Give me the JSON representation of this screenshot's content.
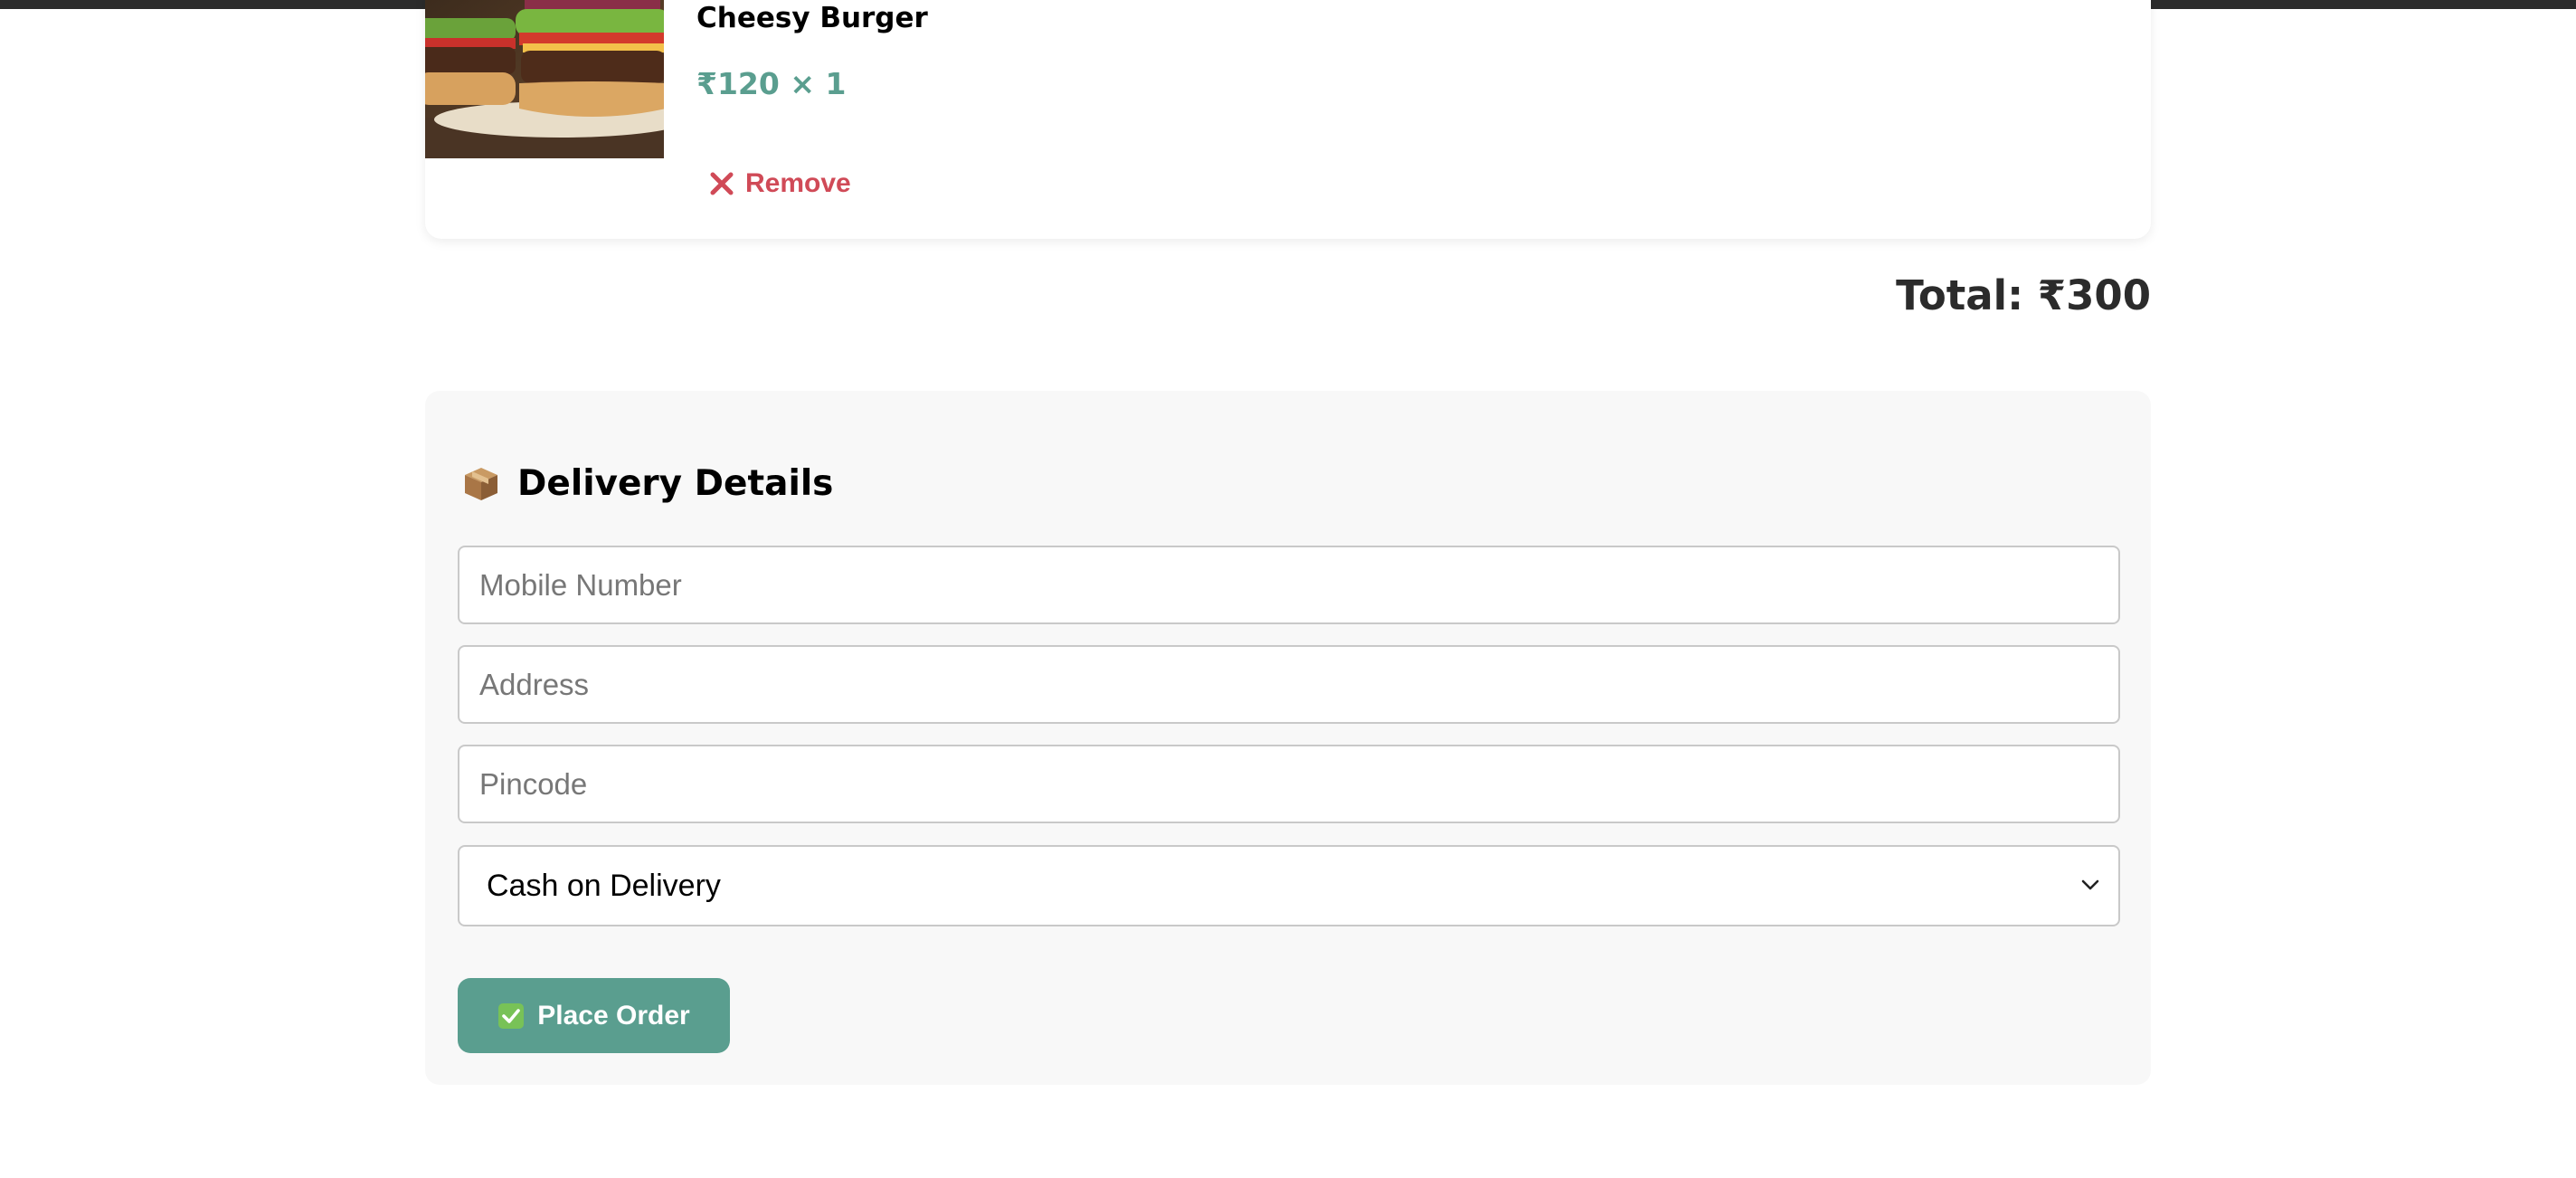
{
  "cart": {
    "item": {
      "name": "Cheesy Burger",
      "price_line": "₹120 × 1",
      "remove_label": "Remove",
      "image_icon": "burger-photo"
    },
    "total_label": "Total: ₹300"
  },
  "delivery": {
    "heading": "Delivery Details",
    "heading_icon": "package-icon",
    "mobile_placeholder": "Mobile Number",
    "address_placeholder": "Address",
    "pincode_placeholder": "Pincode",
    "payment_method": "Cash on Delivery",
    "place_order_label": "Place Order"
  },
  "colors": {
    "accent": "#5a9e8f",
    "remove": "#d04a57",
    "panel_bg": "#f8f8f8"
  }
}
